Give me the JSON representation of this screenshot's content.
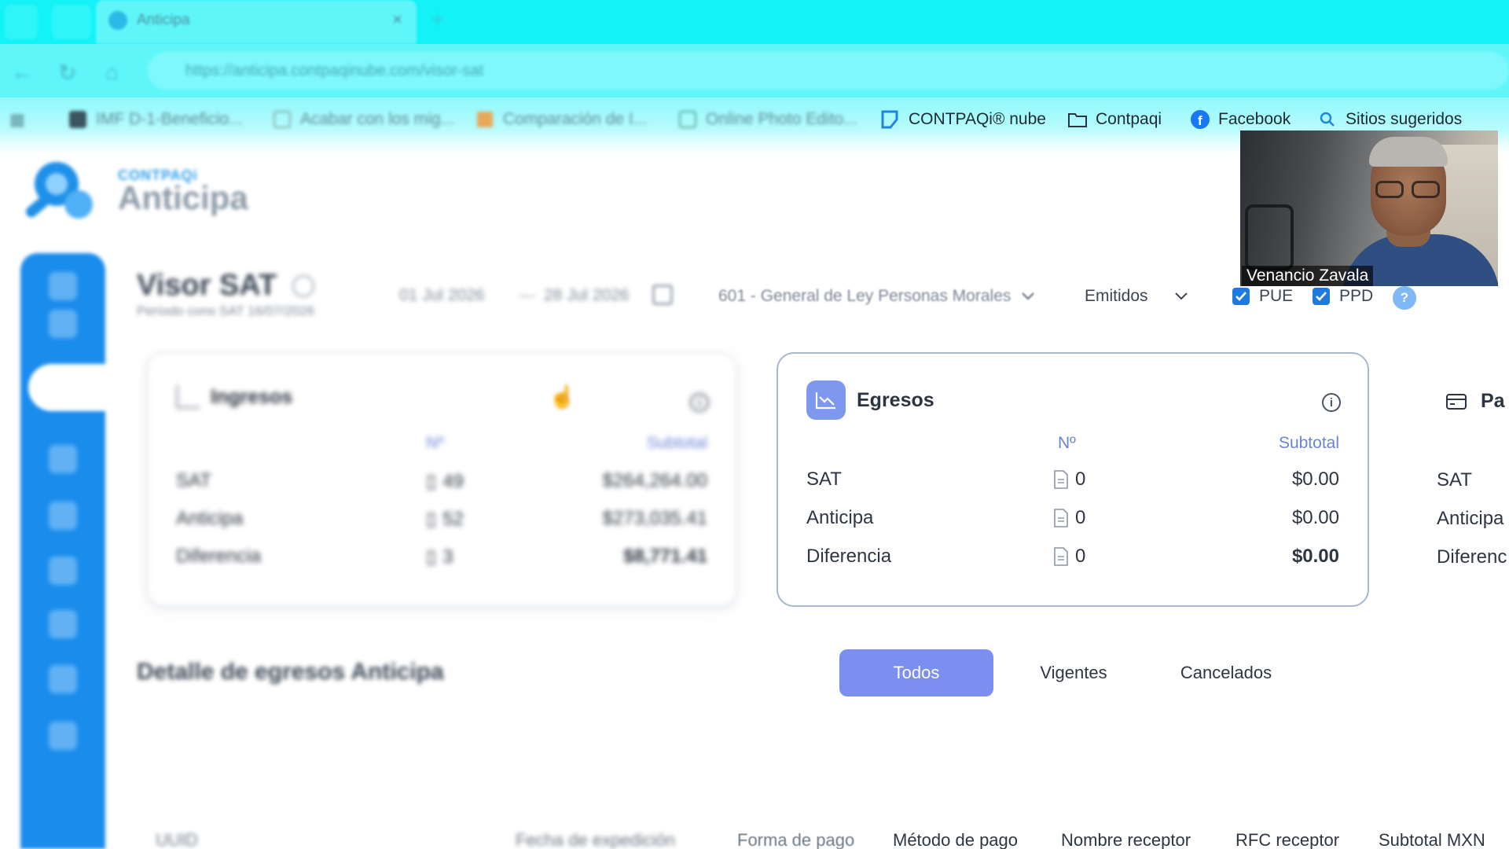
{
  "browser": {
    "tab_title": "Anticipa",
    "url": "https://anticipa.contpaqinube.com/visor-sat",
    "bookmarks": [
      {
        "label": "IMF D-1-Beneficio...",
        "icon": "app-icon",
        "blurred": true
      },
      {
        "label": "Acabar con los mig...",
        "icon": "page-icon",
        "blurred": true
      },
      {
        "label": "Comparación de I...",
        "icon": "image-icon",
        "blurred": true
      },
      {
        "label": "Online Photo Edito...",
        "icon": "photo-icon",
        "blurred": true
      },
      {
        "label": "CONTPAQi® nube",
        "icon": "contpaqi-icon",
        "blurred": false
      },
      {
        "label": "Contpaqi",
        "icon": "folder-icon",
        "blurred": false
      },
      {
        "label": "Facebook",
        "icon": "facebook-icon",
        "blurred": false
      },
      {
        "label": "Sitios sugeridos",
        "icon": "search-icon",
        "blurred": false
      }
    ]
  },
  "brand": {
    "small": "CONTPAQi",
    "name": "Anticipa"
  },
  "header": {
    "title": "Visor SAT",
    "subtitle": "Período cons SAT 16/07/2026",
    "date_from": "01 Jul 2026",
    "date_sep": "—",
    "date_to": "28 Jul 2026",
    "regime": "601 - General de Ley Personas Morales",
    "type": "Emitidos",
    "checks": [
      {
        "label": "PUE",
        "checked": true
      },
      {
        "label": "PPD",
        "checked": true
      }
    ],
    "help": "?"
  },
  "cards": {
    "ingresos": {
      "title": "Ingresos",
      "col_n": "Nº",
      "col_subtotal": "Subtotal",
      "rows": [
        {
          "label": "SAT",
          "count": "49",
          "subtotal": "$264,264.00"
        },
        {
          "label": "Anticipa",
          "count": "52",
          "subtotal": "$273,035.41"
        },
        {
          "label": "Diferencia",
          "count": "3",
          "subtotal": "$8,771.41"
        }
      ]
    },
    "egresos": {
      "title": "Egresos",
      "col_n": "Nº",
      "col_subtotal": "Subtotal",
      "rows": [
        {
          "label": "SAT",
          "count": "0",
          "subtotal": "$0.00"
        },
        {
          "label": "Anticipa",
          "count": "0",
          "subtotal": "$0.00"
        },
        {
          "label": "Diferencia",
          "count": "0",
          "subtotal": "$0.00"
        }
      ]
    },
    "pagos": {
      "title": "Pa",
      "rows": [
        "SAT",
        "Anticipa",
        "Diferenc"
      ]
    }
  },
  "detail": {
    "title": "Detalle de egresos Anticipa",
    "filters": [
      "Todos",
      "Vigentes",
      "Cancelados"
    ],
    "active_filter": "Todos",
    "columns": [
      "UUID",
      "Fecha de expedición",
      "Forma de pago",
      "Método de pago",
      "Nombre receptor",
      "RFC receptor",
      "Subtotal MXN"
    ]
  },
  "video": {
    "participant": "Venancio Zavala"
  },
  "colors": {
    "accent": "#7b8ff0",
    "sidebar": "#1a8cec",
    "chrome": "#13f2f7",
    "checkbox": "#1d7be0"
  }
}
